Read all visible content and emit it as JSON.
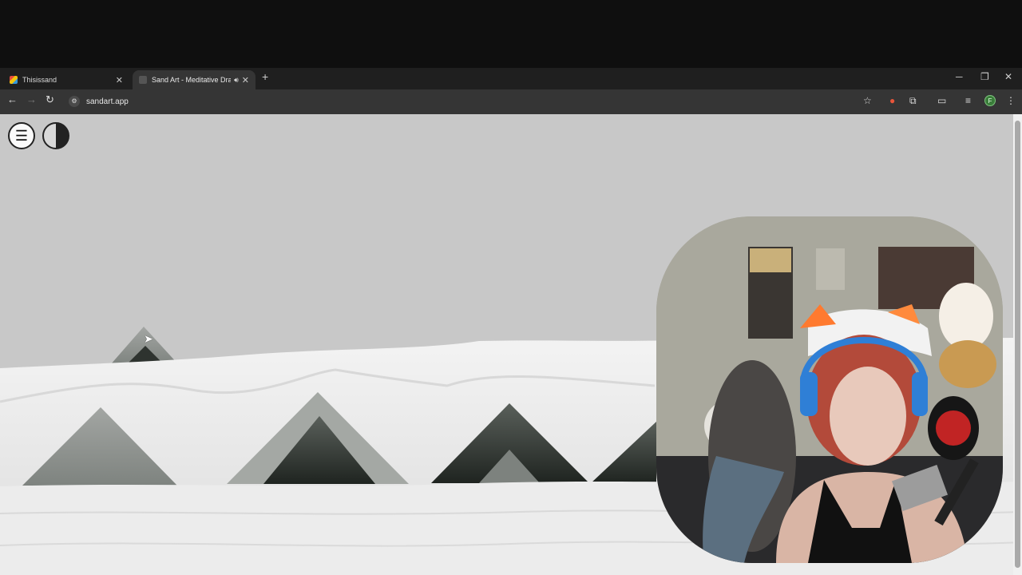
{
  "browser": {
    "tabs": [
      {
        "title": "Thisissand",
        "active": false
      },
      {
        "title": "Sand Art - Meditative Drawing",
        "active": true
      }
    ],
    "url": "sandart.app",
    "profile_initial": "F",
    "colors": {
      "tabbar": "#1f1f1f",
      "toolbar": "#353535",
      "active_tab": "#353535"
    },
    "icons": [
      "back-icon",
      "forward-icon",
      "reload-icon",
      "star-icon",
      "extension-icon",
      "menu-dots-icon"
    ]
  },
  "sandart": {
    "menu_icon": "hamburger-icon",
    "theme_icon": "contrast-icon",
    "colors": {
      "sky": "#c8c8c8",
      "sand": "#eeeeee",
      "dark_sand": "#2b302c"
    }
  },
  "overlay": {
    "webcam": "streamer-webcam"
  }
}
